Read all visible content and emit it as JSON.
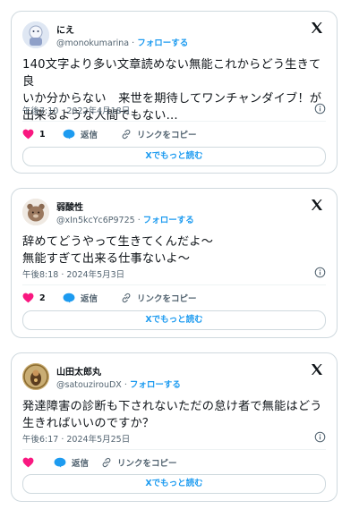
{
  "tweets": [
    {
      "name": "にえ",
      "handle": "@monokumarina",
      "separator": "·",
      "follow_label": "フォローする",
      "text": "140文字より多い文章読めない無能これからどう生きて良\nいか分からない　来世を期待してワンチャンダイブ！が\n出来るような人間でもない...",
      "timestamp": "午後7:10 · 2022年4月18日",
      "like_count": "1",
      "reply_label": "返信",
      "copy_link_label": "リンクをコピー",
      "read_more_label": "Xでもっと読む"
    },
    {
      "name": "弱酸性",
      "handle": "@xIn5kcYc6P9725",
      "separator": "·",
      "follow_label": "フォローする",
      "text": "辞めてどうやって生きてくんだよ～\n無能すぎて出来る仕事ないよ～",
      "timestamp": "午後8:18 · 2024年5月3日",
      "like_count": "2",
      "reply_label": "返信",
      "copy_link_label": "リンクをコピー",
      "read_more_label": "Xでもっと読む"
    },
    {
      "name": "山田太郎丸",
      "handle": "@satouzirouDX",
      "separator": "·",
      "follow_label": "フォローする",
      "text": "発達障害の診断も下されないただの怠け者で無能はどう\n生きればいいのですか？",
      "timestamp": "午後6:17 · 2024年5月25日",
      "like_count": "",
      "reply_label": "返信",
      "copy_link_label": "リンクをコピー",
      "read_more_label": "Xでもっと読む"
    }
  ],
  "colors": {
    "like": "#f91880",
    "reply": "#1d9bf0",
    "link": "#1d9bf0",
    "border": "#cfd9de",
    "muted": "#536471"
  },
  "icons": [
    "x-logo-icon",
    "info-icon",
    "heart-icon",
    "reply-bubble-icon",
    "link-icon"
  ]
}
